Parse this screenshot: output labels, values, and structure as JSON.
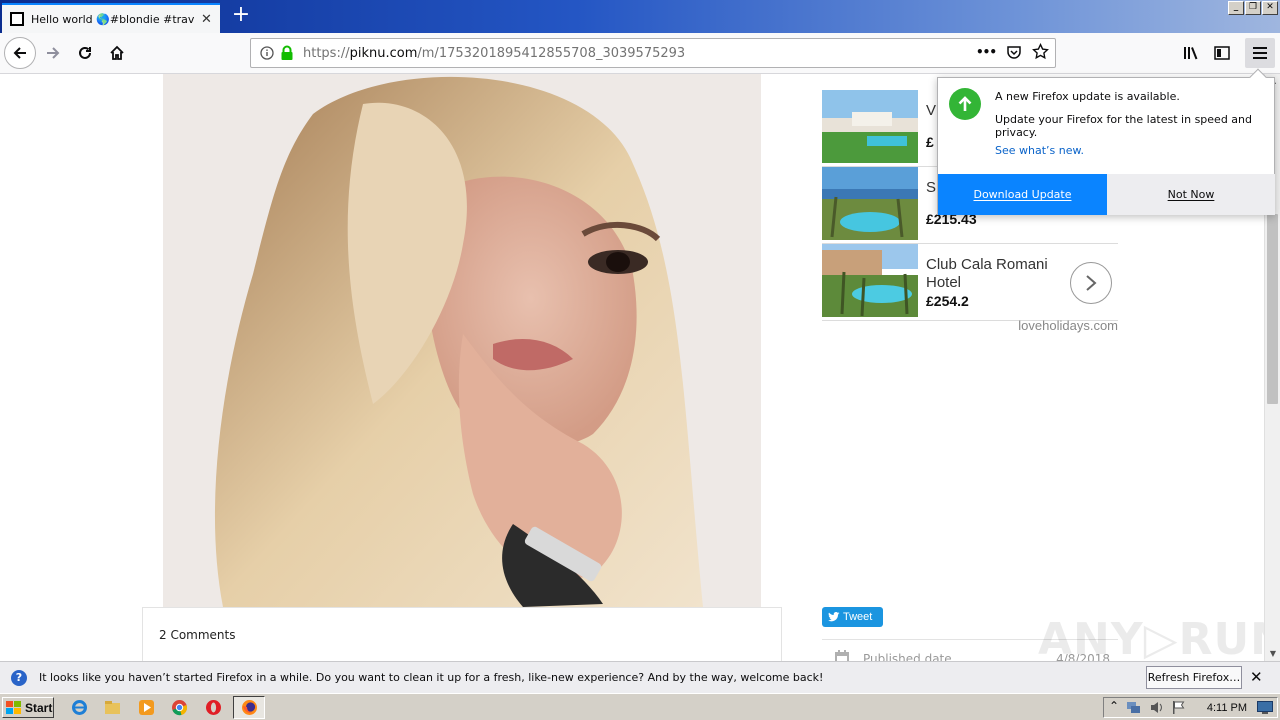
{
  "browser": {
    "tab_title": "Hello world 🌎#blondie #travel #m",
    "tab_close": "✕",
    "new_tab": "+",
    "window_buttons": [
      "_",
      "❐",
      "✕"
    ],
    "url_prefix": "https://",
    "url_host": "piknu.com",
    "url_path": "/m/1753201895412855708_3039575293",
    "page_actions": "•••"
  },
  "page": {
    "comments_label": "2 Comments",
    "ads": [
      {
        "name": "V",
        "price": "£",
        "thumb": "resort-pool-1"
      },
      {
        "name": "S",
        "price": "£215.43",
        "thumb": "resort-pool-2"
      },
      {
        "name": "Club Cala Romani Hotel",
        "price": "£254.2",
        "thumb": "resort-pool-3"
      }
    ],
    "ad_source": "loveholidays.com",
    "tweet_label": "Tweet",
    "published_label": "Published date",
    "published_date": "4/8/2018",
    "watermark": "ANY▷RUN"
  },
  "update_panel": {
    "title": "A new Firefox update is available.",
    "body": "Update your Firefox for the latest in speed and privacy.",
    "link": "See what’s new.",
    "primary_button": "Download Update",
    "secondary_button": "Not Now"
  },
  "notification": {
    "text": "It looks like you haven’t started Firefox in a while. Do you want to clean it up for a fresh, like-new experience? And by the way, welcome back!",
    "button": "Refresh Firefox…",
    "close": "✕",
    "icon": "?"
  },
  "taskbar": {
    "start_label": "Start",
    "clock": "4:11 PM"
  },
  "colors": {
    "accent": "#0a84ff",
    "update_green": "#33b536",
    "tweet_blue": "#1b95e0"
  }
}
